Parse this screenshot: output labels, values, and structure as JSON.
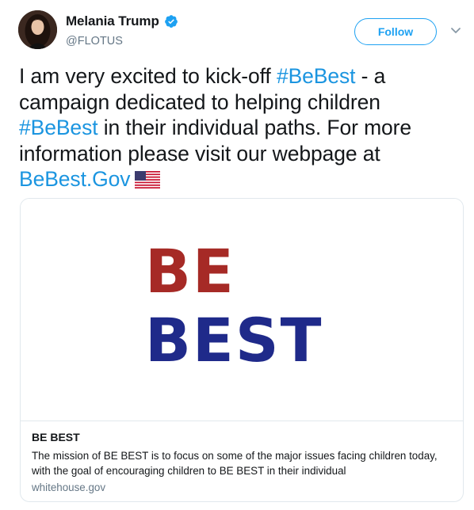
{
  "user": {
    "name": "Melania Trump",
    "handle": "@FLOTUS",
    "verified": true,
    "verified_color": "#1da1f2"
  },
  "actions": {
    "follow_label": "Follow",
    "more_icon": "chevron-down-icon"
  },
  "tweet": {
    "text_1": "I am very excited to kick-off ",
    "hashtag_1": "#BeBest",
    "text_2": " - a campaign dedicated to helping children ",
    "hashtag_2": "#BeBest",
    "text_3": " in their individual paths.  For more information please visit our webpage at ",
    "link": "BeBest.Gov",
    "emoji": "us-flag-emoji",
    "link_color": "#1b95e0"
  },
  "card": {
    "image_line_1": "BE",
    "image_line_2": "BEST",
    "image_color_1": "#a62a26",
    "image_color_2": "#1f2a8a",
    "title": "BE BEST",
    "description": "The mission of BE BEST is to focus on some of the major issues facing children today, with the goal of encouraging children to BE BEST in their individual",
    "domain": "whitehouse.gov"
  }
}
